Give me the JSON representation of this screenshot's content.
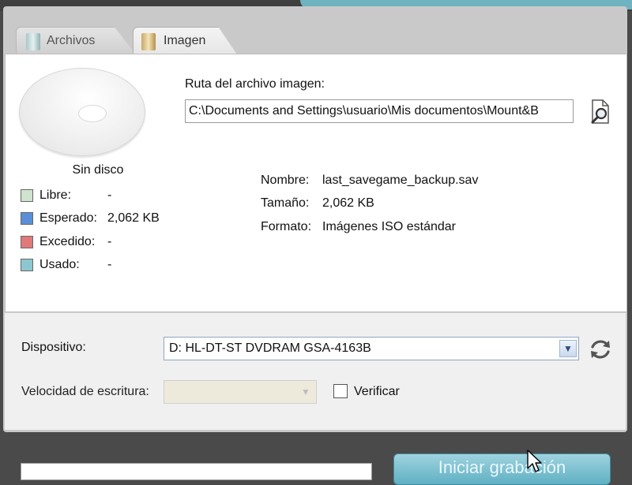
{
  "tabs": [
    {
      "label": "Archivos",
      "active": false
    },
    {
      "label": "Imagen",
      "active": true
    }
  ],
  "disc": {
    "status": "Sin disco",
    "legend": [
      {
        "label": "Libre:",
        "value": "-",
        "color": "#cfe3cf"
      },
      {
        "label": "Esperado:",
        "value": "2,062 KB",
        "color": "#5a8fd8"
      },
      {
        "label": "Excedido:",
        "value": "-",
        "color": "#e07a7a"
      },
      {
        "label": "Usado:",
        "value": "-",
        "color": "#8cc7d0"
      }
    ]
  },
  "image_path": {
    "label": "Ruta del archivo imagen:",
    "value": "C:\\Documents and Settings\\usuario\\Mis documentos\\Mount&B"
  },
  "file_info": [
    {
      "key": "Nombre:",
      "value": "last_savegame_backup.sav"
    },
    {
      "key": "Tamaño:",
      "value": "2,062 KB"
    },
    {
      "key": "Formato:",
      "value": "Imágenes ISO estándar"
    }
  ],
  "device": {
    "label": "Dispositivo:",
    "selected": "D: HL-DT-ST DVDRAM GSA-4163B"
  },
  "speed": {
    "label": "Velocidad de escritura:",
    "selected": ""
  },
  "verify": {
    "label": "Verificar",
    "checked": false
  },
  "start_button": {
    "label": "Iniciar grabación"
  },
  "colors": {
    "accent": "#6fb2c0",
    "button": "#5fb0c3"
  },
  "icons": {
    "browse": "magnifier-document-icon",
    "refresh": "refresh-icon",
    "files_tab": "files-icon",
    "image_tab": "image-icon",
    "dropdown": "chevron-down-icon"
  }
}
